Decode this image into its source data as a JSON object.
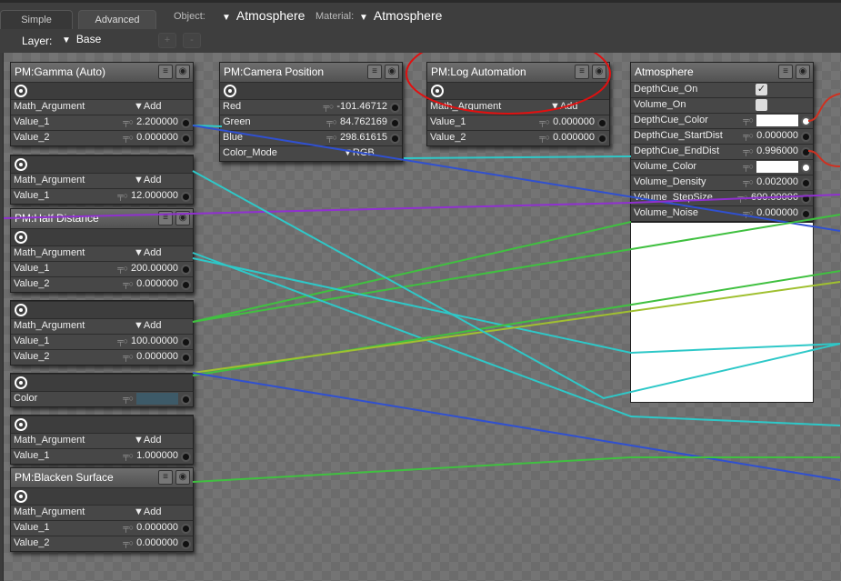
{
  "tabs": [
    {
      "label": "Simple",
      "active": false
    },
    {
      "label": "Advanced",
      "active": true
    }
  ],
  "object": {
    "label": "Object:",
    "value": "Atmosphere"
  },
  "material": {
    "label": "Material:",
    "value": "Atmosphere"
  },
  "layer": {
    "label": "Layer:",
    "value": "Base",
    "add": "+",
    "remove": "-"
  },
  "colors": {
    "cyan": "#2ec8c8",
    "blue": "#3050d0",
    "purple": "#9030d0",
    "green": "#40c040",
    "yellow": "#a0c030",
    "red": "#d03020",
    "annotation": "#e01010"
  },
  "panels": [
    {
      "title": "PM:Gamma (Auto)",
      "rows": [
        {
          "t": "out"
        },
        {
          "l": "Math_Argument",
          "t": "dd",
          "v": "Add"
        },
        {
          "l": "Value_1",
          "t": "num",
          "v": "2.200000"
        },
        {
          "l": "Value_2",
          "t": "num",
          "v": "0.000000"
        }
      ]
    },
    {
      "title": "",
      "rows": [
        {
          "t": "out"
        },
        {
          "l": "Math_Argument",
          "t": "dd",
          "v": "Add"
        },
        {
          "l": "Value_1",
          "t": "num",
          "v": "12.000000"
        }
      ]
    },
    {
      "title": "PM:Half Distance",
      "rows": [
        {
          "t": "out"
        },
        {
          "l": "Math_Argument",
          "t": "dd",
          "v": "Add"
        },
        {
          "l": "Value_1",
          "t": "num",
          "v": "200.00000"
        },
        {
          "l": "Value_2",
          "t": "num",
          "v": "0.000000"
        }
      ]
    },
    {
      "title": "",
      "rows": [
        {
          "t": "out"
        },
        {
          "l": "Math_Argument",
          "t": "dd",
          "v": "Add"
        },
        {
          "l": "Value_1",
          "t": "num",
          "v": "100.00000"
        },
        {
          "l": "Value_2",
          "t": "num",
          "v": "0.000000"
        }
      ]
    },
    {
      "title": "",
      "rows": [
        {
          "t": "out"
        },
        {
          "l": "Color",
          "t": "color",
          "v": "#3d5a68"
        }
      ]
    },
    {
      "title": "",
      "rows": [
        {
          "t": "out"
        },
        {
          "l": "Math_Argument",
          "t": "dd",
          "v": "Add"
        },
        {
          "l": "Value_1",
          "t": "num",
          "v": "1.000000"
        }
      ]
    },
    {
      "title": "PM:Blacken Surface",
      "rows": [
        {
          "t": "out"
        },
        {
          "l": "Math_Argument",
          "t": "dd",
          "v": "Add"
        },
        {
          "l": "Value_1",
          "t": "num",
          "v": "0.000000"
        },
        {
          "l": "Value_2",
          "t": "num",
          "v": "0.000000"
        }
      ]
    },
    {
      "title": "PM:Camera Position",
      "rows": [
        {
          "t": "out"
        },
        {
          "l": "Red",
          "t": "num",
          "v": "-101.46712"
        },
        {
          "l": "Green",
          "t": "num",
          "v": "84.762169"
        },
        {
          "l": "Blue",
          "t": "num",
          "v": "298.61615"
        },
        {
          "l": "Color_Mode",
          "t": "dd",
          "v": "RGB"
        }
      ]
    },
    {
      "title": "PM:Log Automation",
      "rows": [
        {
          "t": "out"
        },
        {
          "l": "Math_Argument",
          "t": "dd",
          "v": "Add"
        },
        {
          "l": "Value_1",
          "t": "num",
          "v": "0.000000"
        },
        {
          "l": "Value_2",
          "t": "num",
          "v": "0.000000"
        }
      ]
    },
    {
      "title": "Atmosphere",
      "rows": [
        {
          "l": "DepthCue_On",
          "t": "check",
          "v": true
        },
        {
          "l": "Volume_On",
          "t": "check",
          "v": false
        },
        {
          "l": "DepthCue_Color",
          "t": "color",
          "v": "#ffffff"
        },
        {
          "l": "DepthCue_StartDist",
          "t": "num",
          "v": "0.000000"
        },
        {
          "l": "DepthCue_EndDist",
          "t": "num",
          "v": "0.996000"
        },
        {
          "l": "Volume_Color",
          "t": "color",
          "v": "#ffffff"
        },
        {
          "l": "Volume_Density",
          "t": "num",
          "v": "0.002000"
        },
        {
          "l": "Volume_StepSize",
          "t": "num",
          "v": "600.00006"
        },
        {
          "l": "Volume_Noise",
          "t": "num",
          "v": "0.000000"
        }
      ]
    }
  ]
}
